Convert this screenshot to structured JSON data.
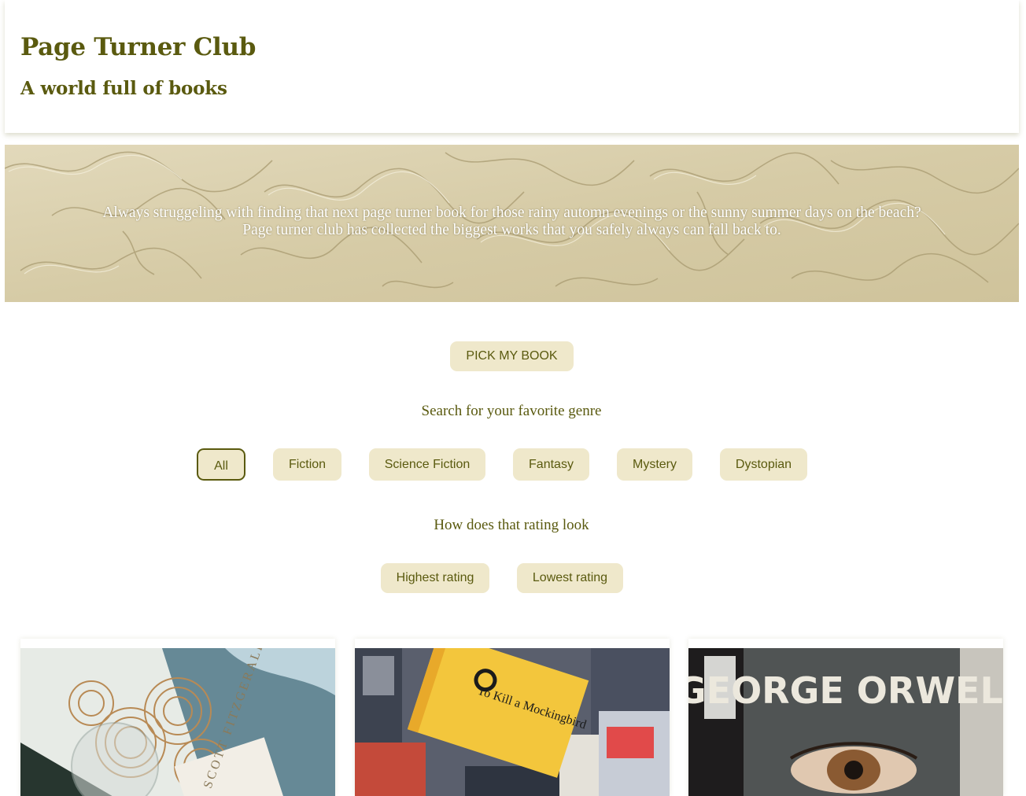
{
  "header": {
    "title": "Page Turner Club",
    "subtitle": "A world full of books"
  },
  "hero": {
    "line1": "Always struggeling with finding that next page turner book for those rainy automn evenings or the sunny summer days on the beach?",
    "line2": "Page turner club has collected the biggest works that you safely always can fall back to."
  },
  "pick_button": "PICK MY BOOK",
  "genre_section": {
    "label": "Search for your favorite genre",
    "genres": [
      "All",
      "Fiction",
      "Science Fiction",
      "Fantasy",
      "Mystery",
      "Dystopian"
    ],
    "selected": "All"
  },
  "rating_section": {
    "label": "How does that rating look",
    "options": [
      "Highest rating",
      "Lowest rating"
    ]
  },
  "books": [
    {
      "cover_text": "SCOTT FITZGERALD"
    },
    {
      "cover_text": "To Kill a Mockingbird"
    },
    {
      "cover_text": "GEORGE ORWELL"
    }
  ],
  "colors": {
    "primary": "#5a5a0f",
    "button_bg": "#efe8cb",
    "hero_bg": "#d9cfae"
  }
}
